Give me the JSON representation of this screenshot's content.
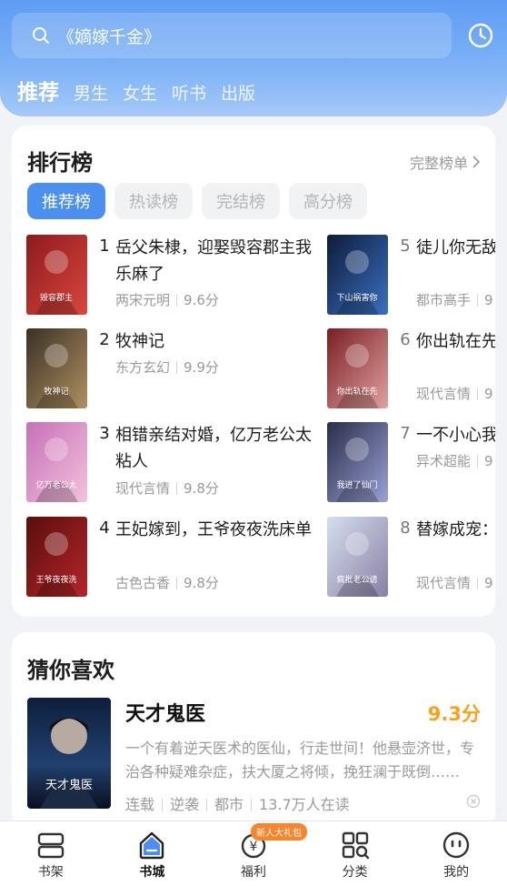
{
  "header": {
    "search_placeholder": "《嫡嫁千金》",
    "tabs": [
      {
        "label": "推荐",
        "active": true
      },
      {
        "label": "男生"
      },
      {
        "label": "女生"
      },
      {
        "label": "听书"
      },
      {
        "label": "出版"
      }
    ]
  },
  "ranking": {
    "title": "排行榜",
    "more": "完整榜单",
    "chips": [
      {
        "label": "推荐榜",
        "active": true
      },
      {
        "label": "热读榜"
      },
      {
        "label": "完结榜"
      },
      {
        "label": "高分榜"
      }
    ],
    "items": [
      {
        "rank": "1",
        "title": "岳父朱棣，迎娶毁容郡主我乐麻了",
        "genre": "两宋元明",
        "score": "9.6分",
        "cover_colors": [
          "#8d1a1c",
          "#d9463e"
        ],
        "cover_text": "毁容郡主"
      },
      {
        "rank": "2",
        "title": "牧神记",
        "genre": "东方玄幻",
        "score": "9.9分",
        "cover_colors": [
          "#3a3026",
          "#b09060"
        ],
        "cover_text": "牧神记"
      },
      {
        "rank": "3",
        "title": "相错亲结对婚，亿万老公太粘人",
        "genre": "现代言情",
        "score": "9.8分",
        "cover_colors": [
          "#c770b8",
          "#f2c2dc"
        ],
        "cover_text": "亿万老公太粘人"
      },
      {
        "rank": "4",
        "title": "王妃嫁到，王爷夜夜洗床单",
        "genre": "古色古香",
        "score": "9.8分",
        "cover_colors": [
          "#5b0d0d",
          "#b3262a"
        ],
        "cover_text": "王爷夜夜洗床单"
      },
      {
        "rank": "5",
        "title": "徒儿你无敌了，你未婚妻吧",
        "genre": "都市高手",
        "score": "9",
        "cover_colors": [
          "#0d1c3b",
          "#3b6fc0"
        ],
        "cover_text": "下山祸害你未婚妻吧"
      },
      {
        "rank": "6",
        "title": "你出轨在先，我哭什么",
        "genre": "现代言情",
        "score": "9",
        "cover_colors": [
          "#7a1f24",
          "#e0a0a0"
        ],
        "cover_text": "你出轨在先我哭什么"
      },
      {
        "rank": "7",
        "title": "一不小心我进了",
        "genre": "异术超能",
        "score": "9",
        "cover_colors": [
          "#2a2d4a",
          "#9aa2d6"
        ],
        "cover_text": "我进了仙门APP"
      },
      {
        "rank": "8",
        "title": "替嫁成宠：疯批老公请排号",
        "genre": "现代言情",
        "score": "9",
        "cover_colors": [
          "#d4dfee",
          "#8a7fa6"
        ],
        "cover_text": "疯批老公请排号"
      }
    ]
  },
  "guess": {
    "title": "猜你喜欢",
    "book": {
      "title": "天才鬼医",
      "score": "9.3分",
      "desc": "一个有着逆天医术的医仙，行走世间！他悬壶济世，专治各种疑难杂症，扶大厦之将倾，挽狂澜于既倒……",
      "status": "连载",
      "tag": "逆袭",
      "genre": "都市",
      "readers": "13.7万人在读",
      "cover_text": "天才鬼医"
    }
  },
  "bottom_nav": [
    {
      "label": "书架",
      "icon": "bookshelf-icon"
    },
    {
      "label": "书城",
      "icon": "bookstore-icon",
      "active": true
    },
    {
      "label": "福利",
      "icon": "welfare-icon",
      "badge": "新人大礼包"
    },
    {
      "label": "分类",
      "icon": "category-icon"
    },
    {
      "label": "我的",
      "icon": "profile-icon"
    }
  ],
  "colors": {
    "accent": "#4b8ff0",
    "score": "#f5a31a",
    "badge": "#f6852c"
  }
}
